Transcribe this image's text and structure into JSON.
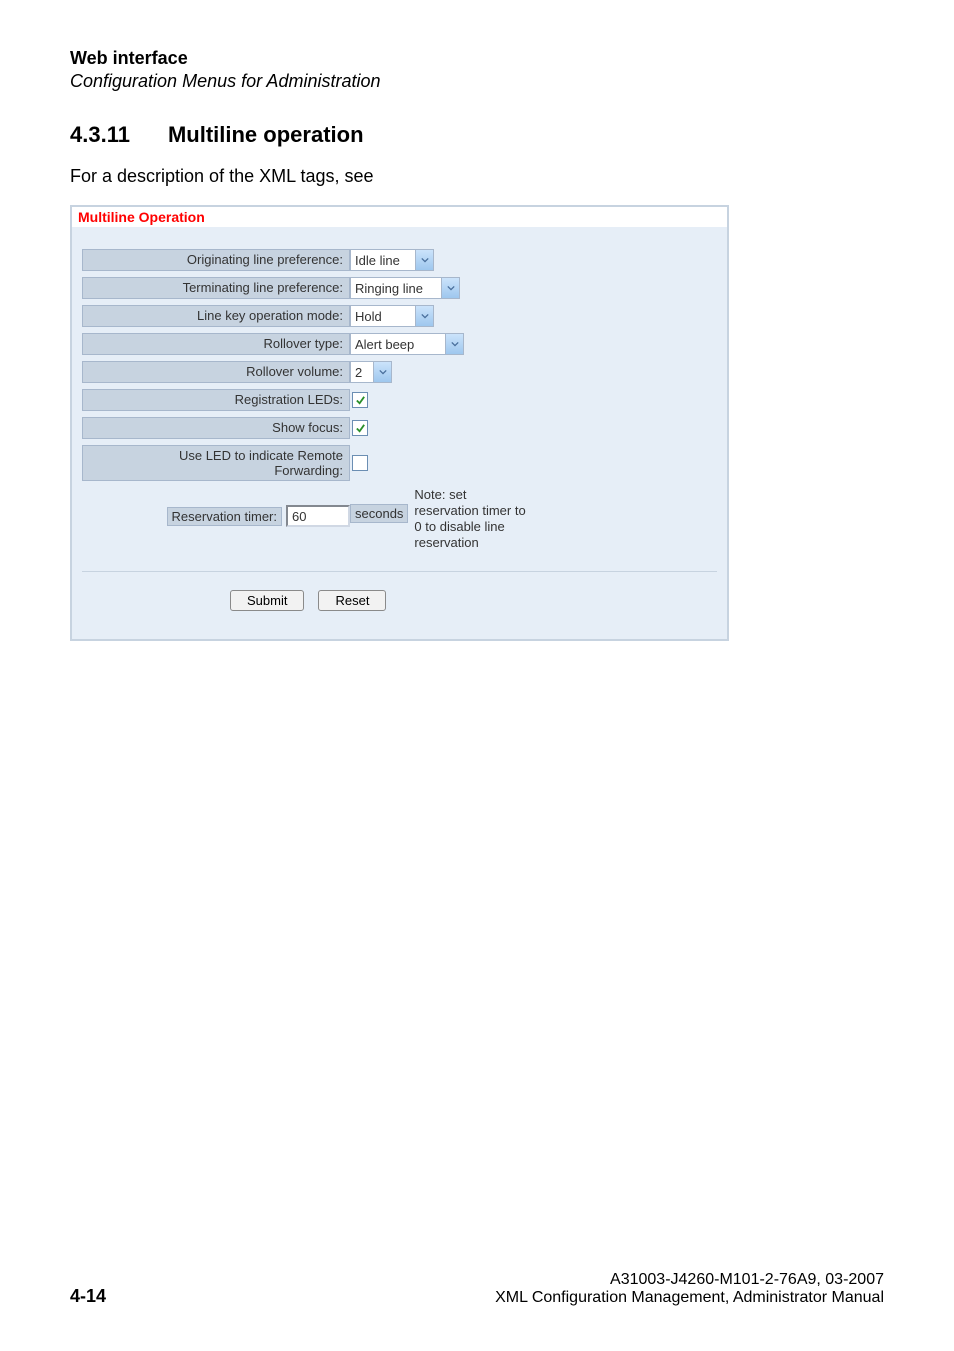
{
  "header": {
    "title": "Web interface",
    "subtitle": "Configuration Menus for Administration"
  },
  "section": {
    "number": "4.3.11",
    "title": "Multiline operation"
  },
  "intro": "For a description of the XML tags, see",
  "panel": {
    "title": "Multiline Operation",
    "rows": {
      "originating": {
        "label": "Originating line preference:",
        "value": "Idle line"
      },
      "terminating": {
        "label": "Terminating line preference:",
        "value": "Ringing line"
      },
      "linekey": {
        "label": "Line key operation mode:",
        "value": "Hold"
      },
      "rollovertype": {
        "label": "Rollover type:",
        "value": "Alert beep"
      },
      "rollovervolume": {
        "label": "Rollover volume:",
        "value": "2"
      },
      "regleds": {
        "label": "Registration LEDs:",
        "checked": true
      },
      "showfocus": {
        "label": "Show focus:",
        "checked": true
      },
      "ledremote": {
        "label_line1": "Use LED to indicate Remote",
        "label_line2": "Forwarding:",
        "checked": false
      },
      "reservation": {
        "label": "Reservation timer:",
        "value": "60",
        "unit": "seconds",
        "note_l1": "Note: set",
        "note_l2": "reservation timer to",
        "note_l3": "0 to disable line",
        "note_l4": "reservation"
      }
    },
    "buttons": {
      "submit": "Submit",
      "reset": "Reset"
    }
  },
  "footer": {
    "page": "4-14",
    "right_l1": "A31003-J4260-M101-2-76A9, 03-2007",
    "right_l2": "XML Configuration Management, Administrator Manual"
  }
}
